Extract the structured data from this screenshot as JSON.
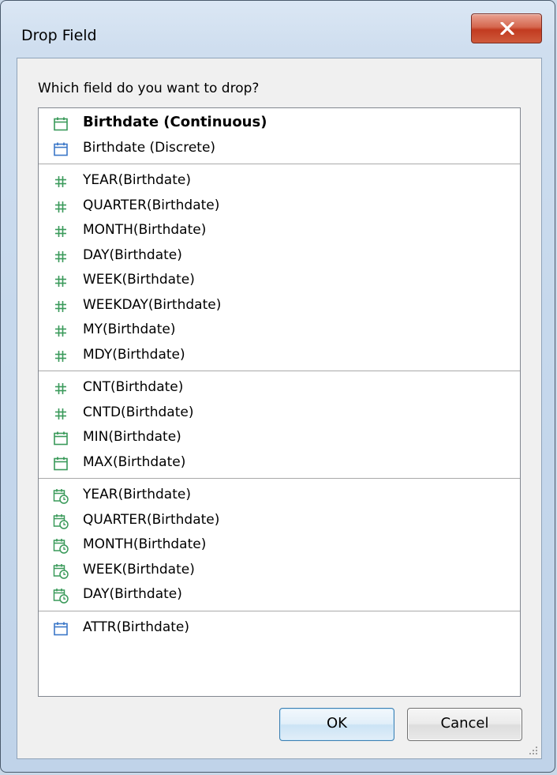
{
  "dialog": {
    "title": "Drop Field",
    "question": "Which field do you want to drop?",
    "ok_label": "OK",
    "cancel_label": "Cancel",
    "close_icon": "close-icon"
  },
  "colors": {
    "green_icon": "#3a9a5a",
    "blue_icon": "#3c78c8",
    "close_button": "#c94a30"
  },
  "groups": [
    {
      "items": [
        {
          "label": "Birthdate (Continuous)",
          "icon": "calendar-icon",
          "icon_color": "green",
          "bold": true
        },
        {
          "label": "Birthdate (Discrete)",
          "icon": "calendar-icon",
          "icon_color": "blue",
          "bold": false
        }
      ]
    },
    {
      "items": [
        {
          "label": "YEAR(Birthdate)",
          "icon": "hash-icon",
          "icon_color": "green"
        },
        {
          "label": "QUARTER(Birthdate)",
          "icon": "hash-icon",
          "icon_color": "green"
        },
        {
          "label": "MONTH(Birthdate)",
          "icon": "hash-icon",
          "icon_color": "green"
        },
        {
          "label": "DAY(Birthdate)",
          "icon": "hash-icon",
          "icon_color": "green"
        },
        {
          "label": "WEEK(Birthdate)",
          "icon": "hash-icon",
          "icon_color": "green"
        },
        {
          "label": "WEEKDAY(Birthdate)",
          "icon": "hash-icon",
          "icon_color": "green"
        },
        {
          "label": "MY(Birthdate)",
          "icon": "hash-icon",
          "icon_color": "green"
        },
        {
          "label": "MDY(Birthdate)",
          "icon": "hash-icon",
          "icon_color": "green"
        }
      ]
    },
    {
      "items": [
        {
          "label": "CNT(Birthdate)",
          "icon": "hash-icon",
          "icon_color": "green"
        },
        {
          "label": "CNTD(Birthdate)",
          "icon": "hash-icon",
          "icon_color": "green"
        },
        {
          "label": "MIN(Birthdate)",
          "icon": "calendar-icon",
          "icon_color": "green"
        },
        {
          "label": "MAX(Birthdate)",
          "icon": "calendar-icon",
          "icon_color": "green"
        }
      ]
    },
    {
      "items": [
        {
          "label": "YEAR(Birthdate)",
          "icon": "calendar-clock-icon",
          "icon_color": "green"
        },
        {
          "label": "QUARTER(Birthdate)",
          "icon": "calendar-clock-icon",
          "icon_color": "green"
        },
        {
          "label": "MONTH(Birthdate)",
          "icon": "calendar-clock-icon",
          "icon_color": "green"
        },
        {
          "label": "WEEK(Birthdate)",
          "icon": "calendar-clock-icon",
          "icon_color": "green"
        },
        {
          "label": "DAY(Birthdate)",
          "icon": "calendar-clock-icon",
          "icon_color": "green"
        }
      ]
    },
    {
      "items": [
        {
          "label": "ATTR(Birthdate)",
          "icon": "calendar-icon",
          "icon_color": "blue"
        }
      ]
    }
  ]
}
